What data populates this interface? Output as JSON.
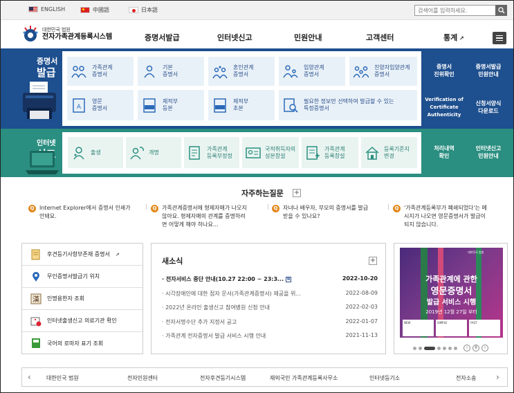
{
  "languages": [
    {
      "label": "ENGLISH",
      "flag": "us-flag-icon"
    },
    {
      "label": "中國語",
      "flag": "china-flag-icon"
    },
    {
      "label": "日本語",
      "flag": "japan-flag-icon"
    }
  ],
  "search": {
    "placeholder": "검색어를 입력하세요."
  },
  "logo": {
    "sub": "대한민국 법원",
    "main": "전자가족관계등록시스템"
  },
  "nav": [
    "증명서발급",
    "인터넷신고",
    "민원안내",
    "고객센터",
    "통계"
  ],
  "certificate": {
    "title_1": "증명서",
    "title_2": "발급",
    "cards": [
      {
        "l1": "가족관계",
        "l2": "증명서"
      },
      {
        "l1": "기본",
        "l2": "증명서"
      },
      {
        "l1": "혼인관계",
        "l2": "증명서"
      },
      {
        "l1": "입양관계",
        "l2": "증명서"
      },
      {
        "l1": "친양자입양관계",
        "l2": "증명서"
      },
      {
        "l1": "영문",
        "l2": "증명서"
      },
      {
        "l1": "제적부",
        "l2": "등본"
      },
      {
        "l1": "제적부",
        "l2": "초본"
      },
      {
        "l1": "필요한 정보만 선택하여 발급할 수 있는",
        "l2": "특정증명서"
      }
    ],
    "side": [
      {
        "l1": "증명서",
        "l2": "진위확인",
        "l3": ""
      },
      {
        "l1": "증명서발급",
        "l2": "민원안내",
        "l3": ""
      },
      {
        "l1": "Verification of",
        "l2": "Certificate",
        "l3": "Authenticity"
      },
      {
        "l1": "신청서양식",
        "l2": "다운로드",
        "l3": ""
      }
    ]
  },
  "report": {
    "title_1": "인터넷",
    "title_2": "신고",
    "cards": [
      {
        "l1": "출생",
        "l2": ""
      },
      {
        "l1": "개명",
        "l2": ""
      },
      {
        "l1": "가족관계",
        "l2": "등록부정정"
      },
      {
        "l1": "국적취득자의",
        "l2": "성본창설"
      },
      {
        "l1": "가족관계",
        "l2": "등록창설"
      },
      {
        "l1": "등록기준지",
        "l2": "변경"
      }
    ],
    "side": [
      {
        "l1": "처리내역",
        "l2": "확인"
      },
      {
        "l1": "인터넷신고",
        "l2": "민원안내"
      }
    ]
  },
  "faq": {
    "title": "자주하는질문",
    "plus": "+",
    "badge": "Q",
    "items": [
      {
        "l1": "Internet Explorer에서 증명서 인쇄가",
        "l2": "안돼요.",
        "l3": ""
      },
      {
        "l1": "가족관계증명서에 형제자매가 나오지",
        "l2": "않아요. 형제자매의 관계를 증명하려",
        "l3": "면 어떻게 해야 하나요..."
      },
      {
        "l1": "자녀나 배우자, 부모의 증명서를 발급",
        "l2": "받을 수 있나요?",
        "l3": ""
      },
      {
        "l1": "'가족관계등록부가 폐쇄되었다'는 메",
        "l2": "시지가 나오면 영문증명서가 발급이",
        "l3": "되지 않습니다."
      }
    ]
  },
  "quick_links": [
    {
      "label": "후견등기사항부존재 증명서",
      "icon": "document-icon",
      "ext": "↗"
    },
    {
      "label": "무인증명서발급기 위치",
      "icon": "location-pin-icon",
      "ext": ""
    },
    {
      "label": "인명용한자 조회",
      "icon": "hanja-icon",
      "ext": ""
    },
    {
      "label": "인터넷출생신고 의료기관 확인",
      "icon": "hospital-icon",
      "ext": ""
    },
    {
      "label": "국어의 로마자 표기 조회",
      "icon": "book-icon",
      "ext": ""
    }
  ],
  "news": {
    "title": "새소식",
    "plus": "+",
    "new_mark": "N",
    "items": [
      {
        "title": "전자서비스 중단 안내(10.27 22:00 ~ 23:3...",
        "date": "2022-10-20"
      },
      {
        "title": "시각장애인에 대한 점자 문서(가족관계증명서) 제공을 위...",
        "date": "2022-08-09"
      },
      {
        "title": "2022년 온라인 출생신고 참여병원 신청 안내",
        "date": "2022-02-03"
      },
      {
        "title": "전자서명수단 추가 지정서 공고",
        "date": "2022-01-07"
      },
      {
        "title": "가족관계 전자증명서 발급 서비스 시행 안내",
        "date": "2021-11-13"
      }
    ]
  },
  "banner": {
    "top": "대한민국 법원",
    "l1": "가족관계에 관한",
    "l2": "영문증명서",
    "l3": "발급 서비스 시행",
    "l4": "2019년 12월 27일 부터",
    "cards": [
      "NEW",
      "SIMPLE",
      "FAST"
    ],
    "prev": "‹",
    "pause": "II",
    "next": "›"
  },
  "footer": {
    "prev": "‹",
    "next": "›",
    "links": [
      "대한민국 법원",
      "전자민원센터",
      "전자후견등기시스템",
      "재외국민 가족관계등록사무소",
      "인터넷등기소",
      "전자소송"
    ]
  },
  "colors": {
    "blue_band": "#1e4f8e",
    "green_band": "#2a8e80",
    "faq_badge": "#e28a1e"
  }
}
